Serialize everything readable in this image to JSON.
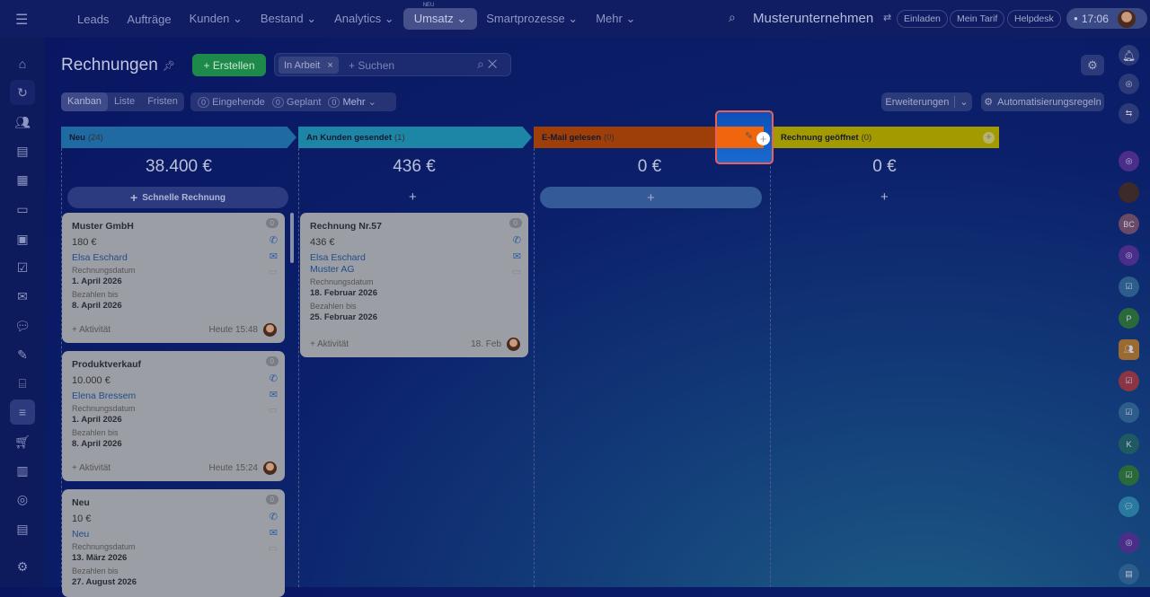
{
  "nav": {
    "items": [
      "Leads",
      "Aufträge",
      "Kunden",
      "Bestand",
      "Analytics",
      "Umsatz",
      "Smartprozesse",
      "Mehr"
    ],
    "active_badge": "NEU",
    "company": "Musterunternehmen",
    "invite": "Einladen",
    "tariff": "Mein Tarif",
    "helpdesk": "Helpdesk",
    "time": "17:06"
  },
  "page": {
    "title": "Rechnungen",
    "create": "+ Erstellen",
    "filter_tag": "In Arbeit",
    "search_placeholder": "+ Suchen",
    "views": [
      "Kanban",
      "Liste",
      "Fristen"
    ],
    "counters": [
      {
        "count": "0",
        "label": "Eingehende"
      },
      {
        "count": "0",
        "label": "Geplant"
      },
      {
        "count": "0",
        "label": "Mehr"
      }
    ],
    "extensions": "Erweiterungen",
    "automation": "Automatisierungsregeln"
  },
  "columns": [
    {
      "title": "Neu",
      "count": "(24)",
      "sum": "38.400 €",
      "add": "Schnelle Rechnung",
      "color": "#1f6aa0"
    },
    {
      "title": "An Kunden gesendet",
      "count": "(1)",
      "sum": "436 €",
      "color": "#1d86a6"
    },
    {
      "title": "E-Mail gelesen",
      "count": "(0)",
      "sum": "0 €",
      "color": "#9e3f0a"
    },
    {
      "title": "Rechnung geöffnet",
      "count": "(0)",
      "sum": "0 €",
      "color": "#a39a00"
    }
  ],
  "cards": [
    {
      "title": "Muster GmbH",
      "amount": "180 €",
      "contact": "Elsa Eschard",
      "date_label": "Rechnungsdatum",
      "date": "1. April 2026",
      "due_label": "Bezahlen bis",
      "due": "8. April 2026",
      "activity": "+ Aktivität",
      "time": "Heute 15:48",
      "badge": "0"
    },
    {
      "title": "Produktverkauf",
      "amount": "10.000 €",
      "contact": "Elena Bressem",
      "date_label": "Rechnungsdatum",
      "date": "1. April 2026",
      "due_label": "Bezahlen bis",
      "due": "8. April 2026",
      "activity": "+ Aktivität",
      "time": "Heute 15:24",
      "badge": "0"
    },
    {
      "title": "Neu",
      "amount": "10 €",
      "contact": "Neu",
      "date_label": "Rechnungsdatum",
      "date": "13. März 2026",
      "due_label": "Bezahlen bis",
      "due": "27. August 2026",
      "badge": "0"
    },
    {
      "title": "Rechnung Nr.57",
      "amount": "436 €",
      "contact": "Elsa Eschard",
      "company": "Muster AG",
      "date_label": "Rechnungsdatum",
      "date": "18. Februar 2026",
      "due_label": "Bezahlen bis",
      "due": "25. Februar 2026",
      "activity": "+ Aktivität",
      "time": "18. Feb",
      "badge": "0"
    }
  ],
  "right_bar": {
    "initials": [
      "BC",
      "P",
      "K"
    ]
  }
}
